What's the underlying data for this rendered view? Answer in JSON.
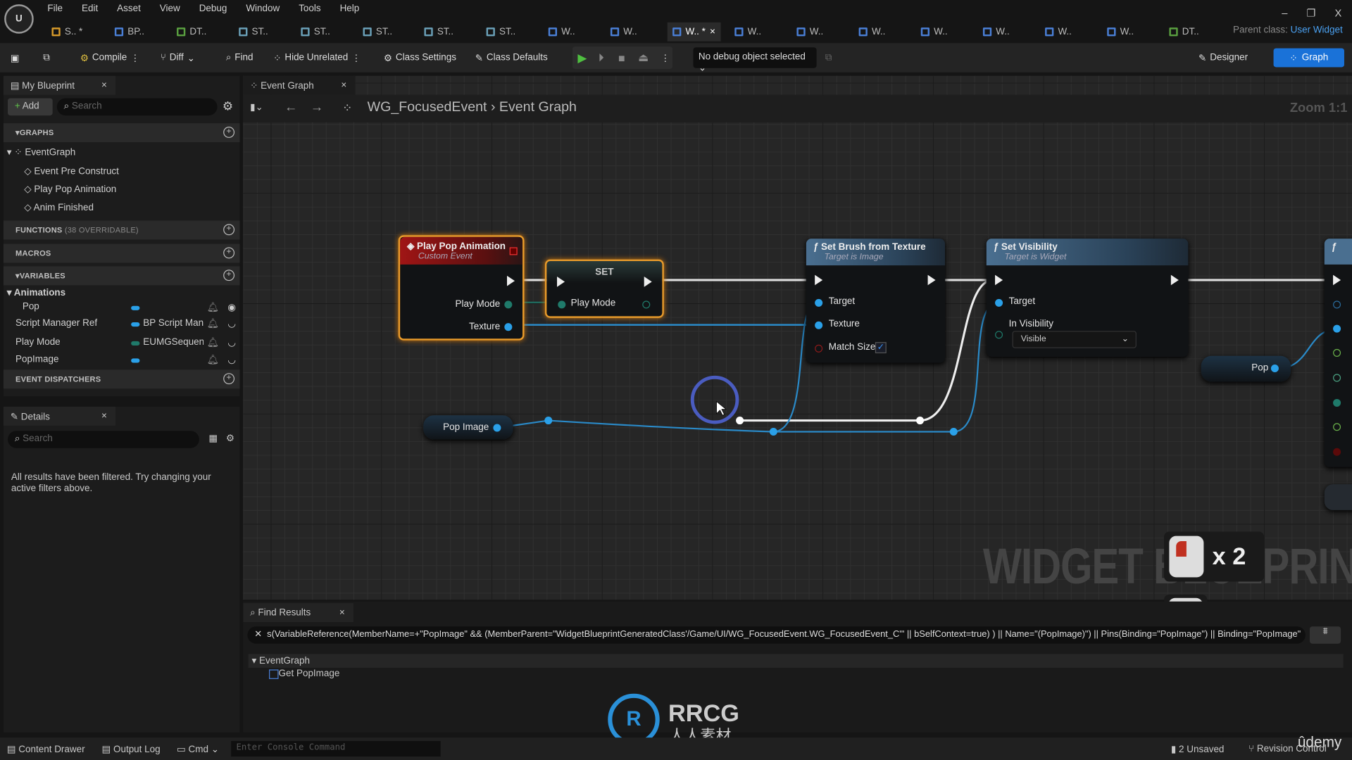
{
  "menu": [
    "File",
    "Edit",
    "Asset",
    "View",
    "Debug",
    "Window",
    "Tools",
    "Help"
  ],
  "window_controls": {
    "minimize": "–",
    "restore": "❐",
    "close": "X"
  },
  "asset_tabs": [
    {
      "label": "S.. *",
      "color": "#d79a2a"
    },
    {
      "label": "BP..",
      "color": "#4a7fd6"
    },
    {
      "label": "DT..",
      "color": "#5aa040"
    },
    {
      "label": "ST..",
      "color": "#6aa0b8"
    },
    {
      "label": "ST..",
      "color": "#6aa0b8"
    },
    {
      "label": "ST..",
      "color": "#6aa0b8"
    },
    {
      "label": "ST..",
      "color": "#6aa0b8"
    },
    {
      "label": "ST..",
      "color": "#6aa0b8"
    },
    {
      "label": "W..",
      "color": "#4a7fd6"
    },
    {
      "label": "W..",
      "color": "#4a7fd6"
    },
    {
      "label": "W.. *",
      "color": "#4a7fd6",
      "active": true
    },
    {
      "label": "W..",
      "color": "#4a7fd6"
    },
    {
      "label": "W..",
      "color": "#4a7fd6"
    },
    {
      "label": "W..",
      "color": "#4a7fd6"
    },
    {
      "label": "W..",
      "color": "#4a7fd6"
    },
    {
      "label": "W..",
      "color": "#4a7fd6"
    },
    {
      "label": "W..",
      "color": "#4a7fd6"
    },
    {
      "label": "W..",
      "color": "#4a7fd6"
    },
    {
      "label": "DT..",
      "color": "#5aa040"
    }
  ],
  "parent_class": {
    "label": "Parent class:",
    "value": "User Widget"
  },
  "toolbar": {
    "compile": "Compile",
    "diff": "Diff",
    "find": "Find",
    "hide_unrelated": "Hide Unrelated",
    "class_settings": "Class Settings",
    "class_defaults": "Class Defaults",
    "debug_object": "No debug object selected",
    "designer": "Designer",
    "graph": "Graph"
  },
  "my_blueprint": {
    "title": "My Blueprint",
    "add": "Add",
    "search_placeholder": "Search",
    "graphs_header": "GRAPHS",
    "event_graph": "EventGraph",
    "events": [
      "Event Pre Construct",
      "Play Pop Animation",
      "Anim Finished"
    ],
    "functions_header": "FUNCTIONS",
    "functions_note": "(38 OVERRIDABLE)",
    "macros_header": "MACROS",
    "variables_header": "VARIABLES",
    "category": "Animations",
    "variables": [
      {
        "name": "Pop",
        "type": "",
        "color": "#2aa0e8"
      },
      {
        "name": "Script Manager Ref",
        "type": "BP Script Mana",
        "color": "#2aa0e8"
      },
      {
        "name": "Play Mode",
        "type": "EUMGSequenc",
        "color": "#1f7a6a"
      },
      {
        "name": "PopImage",
        "type": "",
        "color": "#2aa0e8"
      }
    ],
    "dispatchers_header": "EVENT DISPATCHERS"
  },
  "details": {
    "title": "Details",
    "search_placeholder": "Search",
    "message": "All results have been filtered. Try changing your active filters above."
  },
  "graph_tab": {
    "title": "Event Graph",
    "breadcrumb_root": "WG_FocusedEvent",
    "breadcrumb_leaf": "Event Graph",
    "zoom": "Zoom 1:1",
    "watermark": "WIDGET BLUEPRINT"
  },
  "nodes": {
    "custom_event": {
      "title": "Play Pop Animation",
      "subtitle": "Custom Event",
      "pins": [
        "Play Mode",
        "Texture"
      ]
    },
    "set": {
      "title": "SET",
      "pin": "Play Mode"
    },
    "set_brush": {
      "title": "Set Brush from Texture",
      "subtitle": "Target is Image",
      "pins": [
        "Target",
        "Texture",
        "Match Size"
      ],
      "match_size": true
    },
    "set_visibility": {
      "title": "Set Visibility",
      "subtitle": "Target is Widget",
      "pins": [
        "Target",
        "In Visibility"
      ],
      "visibility": "Visible"
    },
    "pop_image": {
      "label": "Pop Image"
    },
    "pop": {
      "label": "Pop"
    }
  },
  "find_results": {
    "title": "Find Results",
    "query": "s(VariableReference(MemberName=+\"PopImage\" && (MemberParent=\"WidgetBlueprintGeneratedClass'/Game/UI/WG_FocusedEvent.WG_FocusedEvent_C'\" || bSelfContext=true) ) || Name=\"(PopImage)\") || Pins(Binding=\"PopImage\") || Binding=\"PopImage\"",
    "group": "EventGraph",
    "result": "Get PopImage"
  },
  "overlay": {
    "click_count": "x 2",
    "logo_text": "RRCG",
    "logo_sub": "人人素材",
    "udemy": "ûdemy"
  },
  "statusbar": {
    "content_drawer": "Content Drawer",
    "output_log": "Output Log",
    "cmd": "Cmd",
    "console_placeholder": "Enter Console Command",
    "unsaved": "2 Unsaved",
    "revision_control": "Revision Control"
  }
}
